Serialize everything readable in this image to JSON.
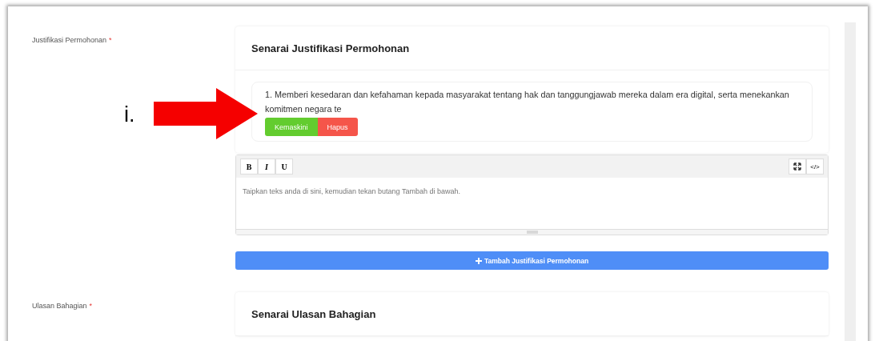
{
  "annotation": {
    "label": "i."
  },
  "fields": [
    {
      "label": "Justifikasi Permohonan",
      "required_mark": "*",
      "card_title": "Senarai Justifikasi Permohonan",
      "items": [
        {
          "text": "1. Memberi kesedaran dan kefahaman kepada masyarakat tentang hak dan tanggungjawab mereka dalam era digital, serta menekankan komitmen negara te",
          "edit_label": "Kemaskini",
          "delete_label": "Hapus"
        }
      ],
      "editor": {
        "toolbar": [
          "B",
          "I",
          "U"
        ],
        "source_button": "</>",
        "placeholder": "Taipkan teks anda di sini, kemudian tekan butang Tambah di bawah."
      },
      "add_button": "Tambah Justifikasi Permohonan"
    },
    {
      "label": "Ulasan Bahagian",
      "required_mark": "*",
      "card_title": "Senarai Ulasan Bahagian"
    }
  ]
}
